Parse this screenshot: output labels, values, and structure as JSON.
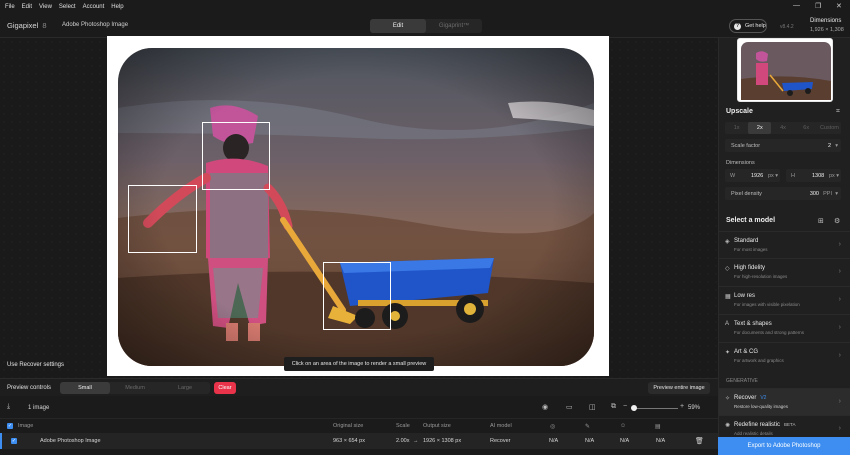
{
  "menu": [
    "File",
    "Edit",
    "View",
    "Select",
    "Account",
    "Help"
  ],
  "window_controls": {
    "minimize": "—",
    "maximize": "❐",
    "close": "✕"
  },
  "title": {
    "app": "Gigapixel",
    "app_version_major": "8",
    "document": "Adobe Photoshop Image",
    "modes": [
      "Edit",
      "Gigaprint™"
    ],
    "get_help": "Get help",
    "version": "v8.4.2",
    "dimensions_label": "Dimensions",
    "dimensions_value": "1,926 × 1,308"
  },
  "canvas": {
    "tooltip": "Click on an area of the image to render a small preview",
    "recover_settings": "Use Recover settings"
  },
  "preview": {
    "label": "Preview controls",
    "sizes": [
      "Small",
      "Medium",
      "Large"
    ],
    "active_size": "Small",
    "clear": "Clear",
    "preview_entire": "Preview entire image"
  },
  "filelist": {
    "count": "1 image",
    "zoom": "59%",
    "zoom_level": 0.05,
    "headers": {
      "image": "Image",
      "original": "Original size",
      "scale": "Scale",
      "output": "Output size",
      "model": "AI model"
    },
    "row": {
      "name": "Adobe Photoshop Image",
      "original": "963 × 654 px",
      "scale": "2.00x",
      "arrow": "→",
      "output": "1926 × 1308 px",
      "model": "Recover",
      "na1": "N/A",
      "na2": "N/A",
      "na3": "N/A",
      "na4": "N/A"
    }
  },
  "panel": {
    "upscale": "Upscale",
    "scales": [
      "1x",
      "2x",
      "4x",
      "6x",
      "Custom"
    ],
    "active_scale": "2x",
    "scale_factor_label": "Scale factor",
    "scale_factor_value": "2",
    "dimensions_label": "Dimensions",
    "w_label": "W",
    "w_value": "1926",
    "h_label": "H",
    "h_value": "1308",
    "unit": "px",
    "pixel_density_label": "Pixel density",
    "pixel_density_value": "300",
    "pixel_density_unit": "PPI",
    "select_model": "Select a model",
    "models": [
      {
        "name": "Standard",
        "desc": "For most images"
      },
      {
        "name": "High fidelity",
        "desc": "For high-resolution images"
      },
      {
        "name": "Low res",
        "desc": "For images with visible pixelation"
      },
      {
        "name": "Text & shapes",
        "desc": "For documents and strong patterns"
      },
      {
        "name": "Art & CG",
        "desc": "For artwork and graphics"
      }
    ],
    "generative_label": "GENERATIVE",
    "gen_models": [
      {
        "name": "Recover",
        "badge": "V2",
        "desc": "Restore low-quality images"
      },
      {
        "name": "Redefine realistic",
        "badge": "BETA",
        "desc": "Add realistic details"
      }
    ],
    "export": "Export to Adobe Photoshop"
  },
  "colors": {
    "accent": "#3d8ef0",
    "clear": "#e8334a",
    "background": "#1b1b1b"
  }
}
